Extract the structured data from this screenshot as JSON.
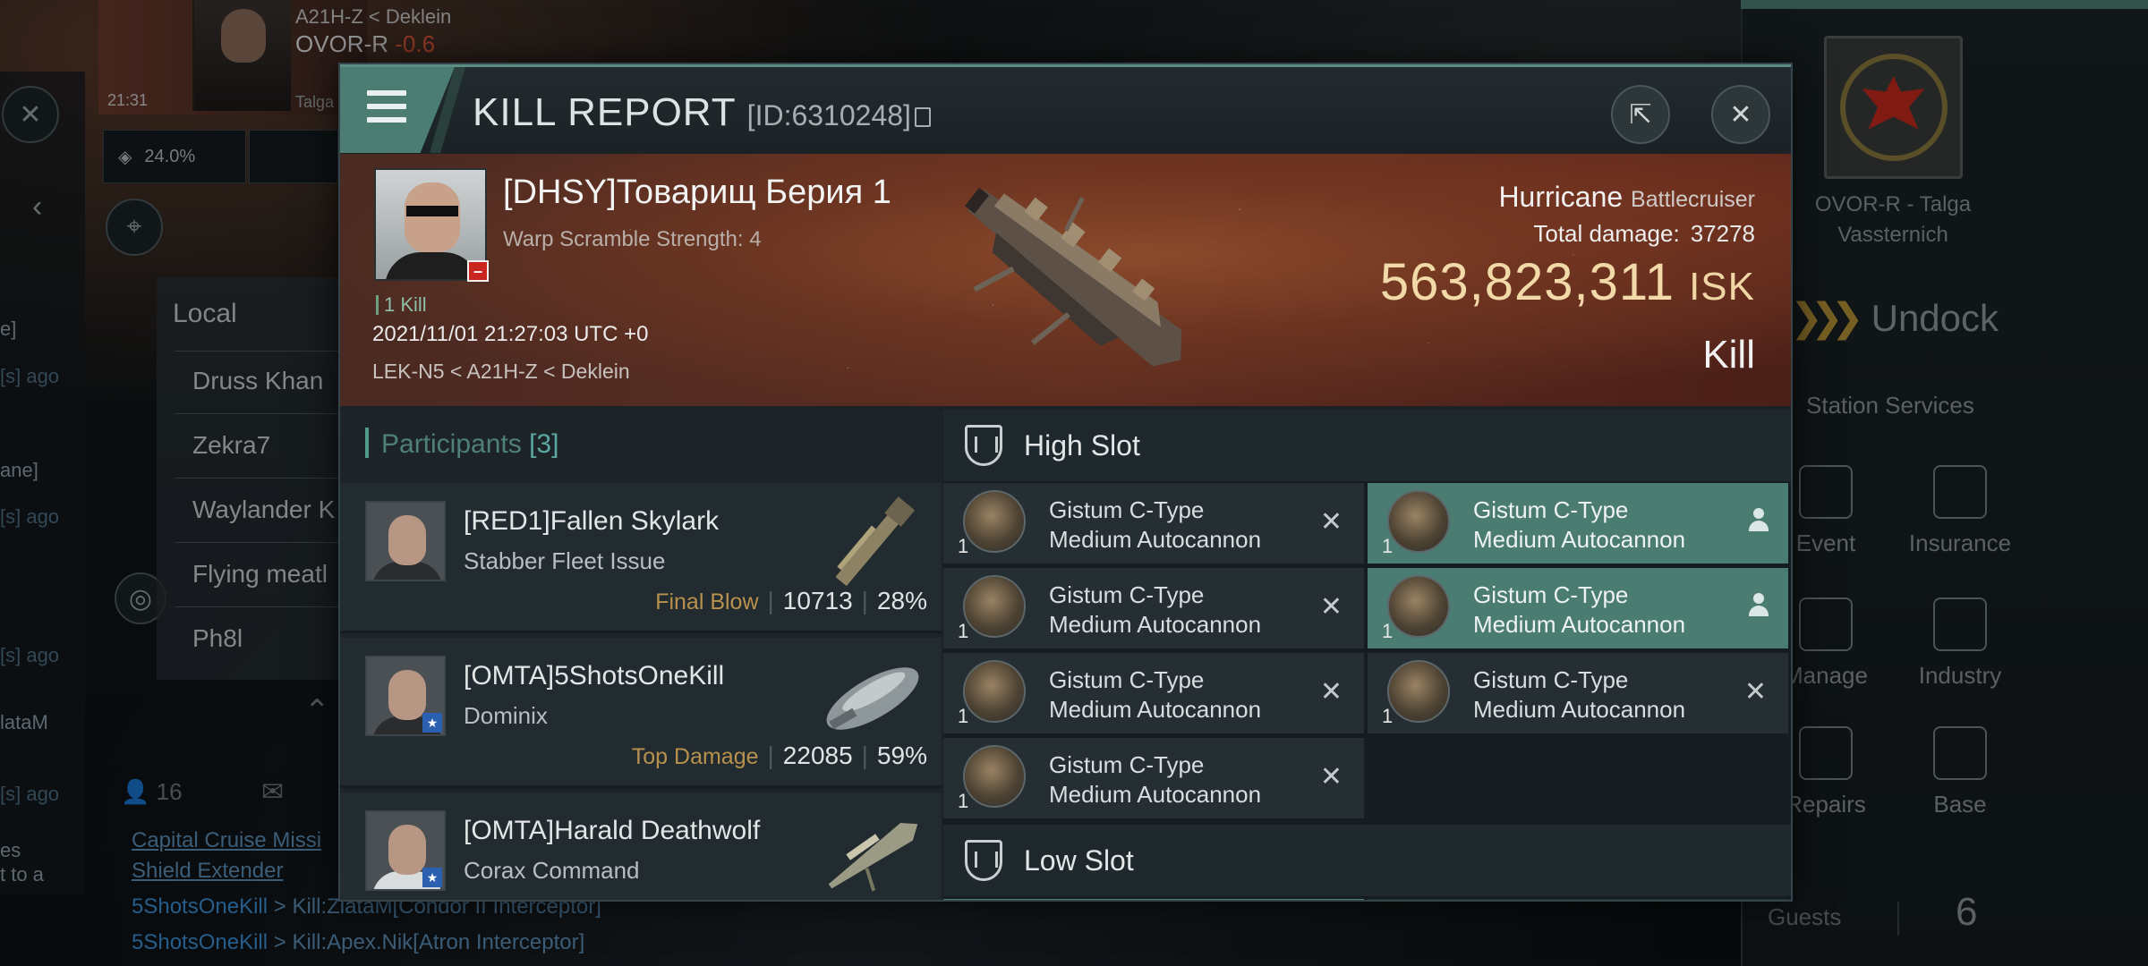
{
  "background": {
    "location_path": "A21H-Z < Deklein",
    "system": "OVOR-R",
    "security": "-0.6",
    "clock": "21:31",
    "talga_short": "Talga",
    "cargo_percent": "24.0%",
    "local": {
      "title": "Local",
      "members": [
        "Druss Khan",
        "Zekra7",
        "Waylander K",
        "Flying meatl",
        "Ph8l"
      ]
    },
    "guest_icon_count": "16",
    "chat": [
      {
        "text": "Capital Cruise Missi"
      },
      {
        "text": "Shield Extender"
      },
      {
        "name": "5ShotsOneKill",
        "text": " > Kill:ZlataM[Condor II Interceptor]"
      },
      {
        "name": "5ShotsOneKill",
        "text": " > Kill:Apex.Nik[Atron Interceptor]"
      }
    ],
    "left_edge_texts": [
      "e]",
      "[s] ago",
      "ane]",
      "[s] ago",
      "[s] ago",
      "lataM",
      "[s] ago",
      "es",
      "t to a"
    ],
    "station": {
      "name_line1": "OVOR-R - Talga",
      "name_line2": "Vassternich",
      "undock_label": "Undock",
      "services_title": "Station Services",
      "services": [
        "Event",
        "Insurance",
        "Manage",
        "Industry",
        "Repairs",
        "Base"
      ],
      "guests_label": "Guests",
      "guests_count": "6"
    }
  },
  "modal": {
    "title": "KILL REPORT",
    "id_text": "[ID:6310248]",
    "victim": {
      "name": "[DHSY]Товарищ Берия 1",
      "subtitle": "Warp Scramble Strength: 4",
      "kills": "1 Kill",
      "datetime": "2021/11/01 21:27:03 UTC +0",
      "location": "LEK-N5 < A21H-Z < Deklein",
      "ship_name": "Hurricane",
      "ship_class": "Battlecruiser",
      "total_damage_label": "Total damage:",
      "total_damage_value": "37278",
      "isk_value": "563,823,311",
      "isk_unit": "ISK",
      "result": "Kill"
    },
    "participants": {
      "label": "Participants",
      "count": "[3]",
      "rows": [
        {
          "name": "[RED1]Fallen Skylark",
          "ship": "Stabber Fleet Issue",
          "tag": "Final Blow",
          "damage": "10713",
          "percent": "28%"
        },
        {
          "name": "[OMTA]5ShotsOneKill",
          "ship": "Dominix",
          "tag": "Top Damage",
          "damage": "22085",
          "percent": "59%"
        },
        {
          "name": "[OMTA]Harald Deathwolf",
          "ship": "Corax Command",
          "tag": "",
          "damage": "",
          "percent": ""
        }
      ]
    },
    "high_slot": {
      "label": "High Slot",
      "modules": [
        {
          "qty": "1",
          "line1": "Gistum C-Type",
          "line2": "Medium Autocannon",
          "state": "destroyed-x"
        },
        {
          "qty": "1",
          "line1": "Gistum C-Type",
          "line2": "Medium Autocannon",
          "state": "dropped-person"
        },
        {
          "qty": "1",
          "line1": "Gistum C-Type",
          "line2": "Medium Autocannon",
          "state": "destroyed-x"
        },
        {
          "qty": "1",
          "line1": "Gistum C-Type",
          "line2": "Medium Autocannon",
          "state": "dropped-person"
        },
        {
          "qty": "1",
          "line1": "Gistum C-Type",
          "line2": "Medium Autocannon",
          "state": "destroyed-x"
        },
        {
          "qty": "1",
          "line1": "Gistum C-Type",
          "line2": "Medium Autocannon",
          "state": "destroyed-x"
        },
        {
          "qty": "1",
          "line1": "Gistum C-Type",
          "line2": "Medium Autocannon",
          "state": "destroyed-x"
        }
      ]
    },
    "low_slot": {
      "label": "Low Slot"
    },
    "accent_color": "#4b7c72",
    "isk_color": "#f2d9a8",
    "tag_color": "#b8914e"
  }
}
